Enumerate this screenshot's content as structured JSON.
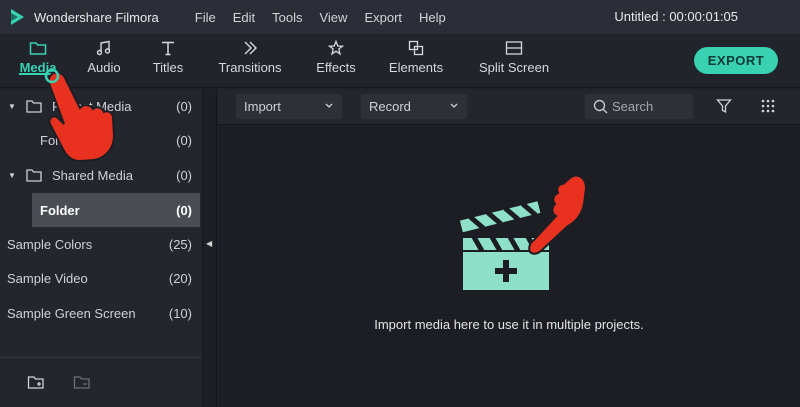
{
  "app": {
    "name": "Wondershare Filmora",
    "project_title": "Untitled : 00:00:01:05",
    "logo_icon": "filmora-logo-icon"
  },
  "menu": [
    "File",
    "Edit",
    "Tools",
    "View",
    "Export",
    "Help"
  ],
  "toolbar": {
    "tabs": [
      {
        "label": "Media",
        "icon": "folder-icon",
        "active": true
      },
      {
        "label": "Audio",
        "icon": "music-note-icon",
        "active": false
      },
      {
        "label": "Titles",
        "icon": "text-t-icon",
        "active": false
      },
      {
        "label": "Transitions",
        "icon": "transition-icon",
        "active": false
      },
      {
        "label": "Effects",
        "icon": "effects-icon",
        "active": false
      },
      {
        "label": "Elements",
        "icon": "elements-icon",
        "active": false
      },
      {
        "label": "Split Screen",
        "icon": "split-screen-icon",
        "active": false
      }
    ],
    "export_label": "EXPORT"
  },
  "library": {
    "project_media": {
      "label": "Project Media",
      "count": "(0)"
    },
    "project_folder": {
      "label": "Folder",
      "count": "(0)"
    },
    "shared_media": {
      "label": "Shared Media",
      "count": "(0)"
    },
    "shared_folder": {
      "label": "Folder",
      "count": "(0)"
    },
    "sample_colors": {
      "label": "Sample Colors",
      "count": "(25)"
    },
    "sample_video": {
      "label": "Sample Video",
      "count": "(20)"
    },
    "sample_green_screen": {
      "label": "Sample Green Screen",
      "count": "(10)"
    }
  },
  "mainbar": {
    "import_label": "Import",
    "record_label": "Record",
    "search_placeholder": "Search"
  },
  "empty_state": {
    "message": "Import media here to use it in multiple projects."
  },
  "colors": {
    "accent": "#38d1b2",
    "hand_red": "#e8311f",
    "clapper_mint": "#8ee0c8"
  }
}
